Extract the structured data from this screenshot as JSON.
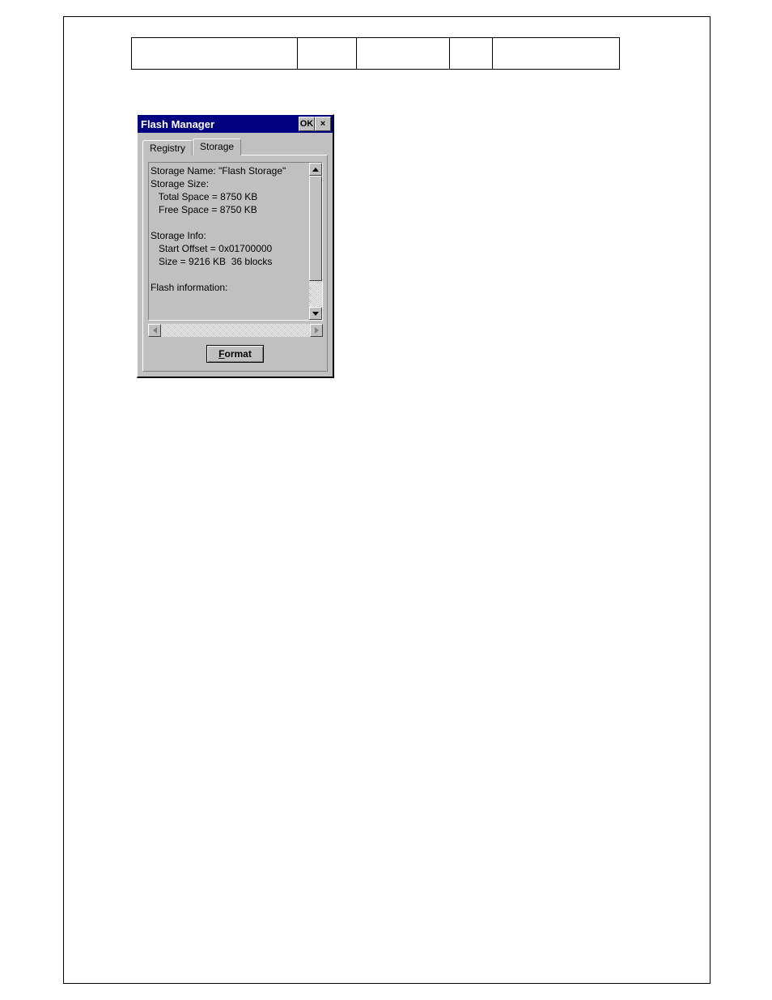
{
  "dialog": {
    "title": "Flash Manager",
    "ok_label": "OK",
    "close_label": "×",
    "tabs": {
      "registry": "Registry",
      "storage": "Storage"
    },
    "format_button_prefix": "F",
    "format_button_rest": "ormat"
  },
  "storage": {
    "line1": "Storage Name: \"Flash Storage\"",
    "line2": "Storage Size:",
    "line3": "   Total Space = 8750 KB",
    "line4": "   Free Space = 8750 KB",
    "line5": "",
    "line6": "Storage Info:",
    "line7": "   Start Offset = 0x01700000",
    "line8": "   Size = 9216 KB  36 blocks",
    "line9": "",
    "line10": "Flash information:"
  }
}
